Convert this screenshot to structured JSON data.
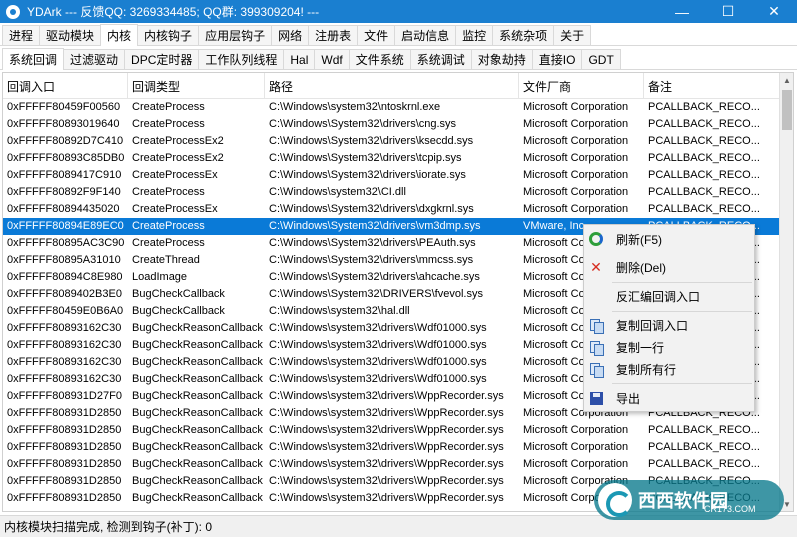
{
  "title": "YDArk --- 反馈QQ: 3269334485; QQ群: 399309204! ---",
  "window_buttons": {
    "minimize": "—",
    "maximize": "☐",
    "close": "✕"
  },
  "main_tabs": [
    "进程",
    "驱动模块",
    "内核",
    "内核钩子",
    "应用层钩子",
    "网络",
    "注册表",
    "文件",
    "启动信息",
    "监控",
    "系统杂项",
    "关于"
  ],
  "sub_tabs": [
    "系统回调",
    "过滤驱动",
    "DPC定时器",
    "工作队列线程",
    "Hal",
    "Wdf",
    "文件系统",
    "系统调试",
    "对象劫持",
    "直接IO",
    "GDT"
  ],
  "columns": [
    "回调入口",
    "回调类型",
    "路径",
    "文件厂商",
    "备注"
  ],
  "rows": [
    [
      "0xFFFFF80459F00560",
      "CreateProcess",
      "C:\\Windows\\system32\\ntoskrnl.exe",
      "Microsoft Corporation",
      "PCALLBACK_RECO..."
    ],
    [
      "0xFFFFF80893019640",
      "CreateProcess",
      "C:\\Windows\\System32\\drivers\\cng.sys",
      "Microsoft Corporation",
      "PCALLBACK_RECO..."
    ],
    [
      "0xFFFFF80892D7C410",
      "CreateProcessEx2",
      "C:\\Windows\\System32\\drivers\\ksecdd.sys",
      "Microsoft Corporation",
      "PCALLBACK_RECO..."
    ],
    [
      "0xFFFFF80893C85DB0",
      "CreateProcessEx2",
      "C:\\Windows\\System32\\drivers\\tcpip.sys",
      "Microsoft Corporation",
      "PCALLBACK_RECO..."
    ],
    [
      "0xFFFFF8089417C910",
      "CreateProcessEx",
      "C:\\Windows\\System32\\drivers\\iorate.sys",
      "Microsoft Corporation",
      "PCALLBACK_RECO..."
    ],
    [
      "0xFFFFF80892F9F140",
      "CreateProcess",
      "C:\\Windows\\system32\\CI.dll",
      "Microsoft Corporation",
      "PCALLBACK_RECO..."
    ],
    [
      "0xFFFFF80894435020",
      "CreateProcessEx",
      "C:\\Windows\\System32\\drivers\\dxgkrnl.sys",
      "Microsoft Corporation",
      "PCALLBACK_RECO..."
    ],
    [
      "0xFFFFF80894E89EC0",
      "CreateProcess",
      "C:\\Windows\\System32\\drivers\\vm3dmp.sys",
      "VMware, Inc.",
      "PCALLBACK_RECO..."
    ],
    [
      "0xFFFFF80895AC3C90",
      "CreateProcess",
      "C:\\Windows\\System32\\drivers\\PEAuth.sys",
      "Microsoft Corporation",
      "PCALLBACK_RECO..."
    ],
    [
      "0xFFFFF80895A31010",
      "CreateThread",
      "C:\\Windows\\System32\\drivers\\mmcss.sys",
      "Microsoft Corporation",
      "PCALLBACK_RECO..."
    ],
    [
      "0xFFFFF80894C8E980",
      "LoadImage",
      "C:\\Windows\\System32\\drivers\\ahcache.sys",
      "Microsoft Corporation",
      "PCALLBACK_RECO..."
    ],
    [
      "0xFFFFF8089402B3E0",
      "BugCheckCallback",
      "C:\\Windows\\System32\\DRIVERS\\fvevol.sys",
      "Microsoft Corporation",
      "PCALLBACK_RECO..."
    ],
    [
      "0xFFFFF80459E0B6A0",
      "BugCheckCallback",
      "C:\\Windows\\system32\\hal.dll",
      "Microsoft Corporation",
      "PCALLBACK_RECO..."
    ],
    [
      "0xFFFFF80893162C30",
      "BugCheckReasonCallback",
      "C:\\Windows\\system32\\drivers\\Wdf01000.sys",
      "Microsoft Corporation",
      "PCALLBACK_RECO..."
    ],
    [
      "0xFFFFF80893162C30",
      "BugCheckReasonCallback",
      "C:\\Windows\\system32\\drivers\\Wdf01000.sys",
      "Microsoft Corporation",
      "PCALLBACK_RECO..."
    ],
    [
      "0xFFFFF80893162C30",
      "BugCheckReasonCallback",
      "C:\\Windows\\system32\\drivers\\Wdf01000.sys",
      "Microsoft Corporation",
      "PCALLBACK_RECO..."
    ],
    [
      "0xFFFFF80893162C30",
      "BugCheckReasonCallback",
      "C:\\Windows\\system32\\drivers\\Wdf01000.sys",
      "Microsoft Corporation",
      "PCALLBACK_RECO..."
    ],
    [
      "0xFFFFF808931D27F0",
      "BugCheckReasonCallback",
      "C:\\Windows\\system32\\drivers\\WppRecorder.sys",
      "Microsoft Corporation",
      "PCALLBACK_RECO..."
    ],
    [
      "0xFFFFF808931D2850",
      "BugCheckReasonCallback",
      "C:\\Windows\\system32\\drivers\\WppRecorder.sys",
      "Microsoft Corporation",
      "PCALLBACK_RECO..."
    ],
    [
      "0xFFFFF808931D2850",
      "BugCheckReasonCallback",
      "C:\\Windows\\system32\\drivers\\WppRecorder.sys",
      "Microsoft Corporation",
      "PCALLBACK_RECO..."
    ],
    [
      "0xFFFFF808931D2850",
      "BugCheckReasonCallback",
      "C:\\Windows\\system32\\drivers\\WppRecorder.sys",
      "Microsoft Corporation",
      "PCALLBACK_RECO..."
    ],
    [
      "0xFFFFF808931D2850",
      "BugCheckReasonCallback",
      "C:\\Windows\\system32\\drivers\\WppRecorder.sys",
      "Microsoft Corporation",
      "PCALLBACK_RECO..."
    ],
    [
      "0xFFFFF808931D2850",
      "BugCheckReasonCallback",
      "C:\\Windows\\system32\\drivers\\WppRecorder.sys",
      "Microsoft Corporation",
      "PCALLBACK_RECO..."
    ],
    [
      "0xFFFFF808931D2850",
      "BugCheckReasonCallback",
      "C:\\Windows\\system32\\drivers\\WppRecorder.sys",
      "Microsoft Corporation",
      "PCALLBACK_RECO..."
    ]
  ],
  "context_menu": [
    {
      "label": "刷新(F5)",
      "icon": "refresh-icon"
    },
    {
      "label": "删除(Del)",
      "icon": "delete-icon"
    },
    {
      "label": "反汇编回调入口",
      "icon": ""
    },
    {
      "label": "复制回调入口",
      "icon": "copy-icon"
    },
    {
      "label": "复制一行",
      "icon": "copy-icon"
    },
    {
      "label": "复制所有行",
      "icon": "copy-icon"
    },
    {
      "label": "导出",
      "icon": "save-icon"
    }
  ],
  "status": "内核模块扫描完成, 检测到钩子(补丁): 0",
  "watermark": {
    "name": "西西软件园",
    "sub": "CR173.COM"
  },
  "colors": {
    "titlebar": "#1a7fd0",
    "selection": "#0a7ad7"
  }
}
